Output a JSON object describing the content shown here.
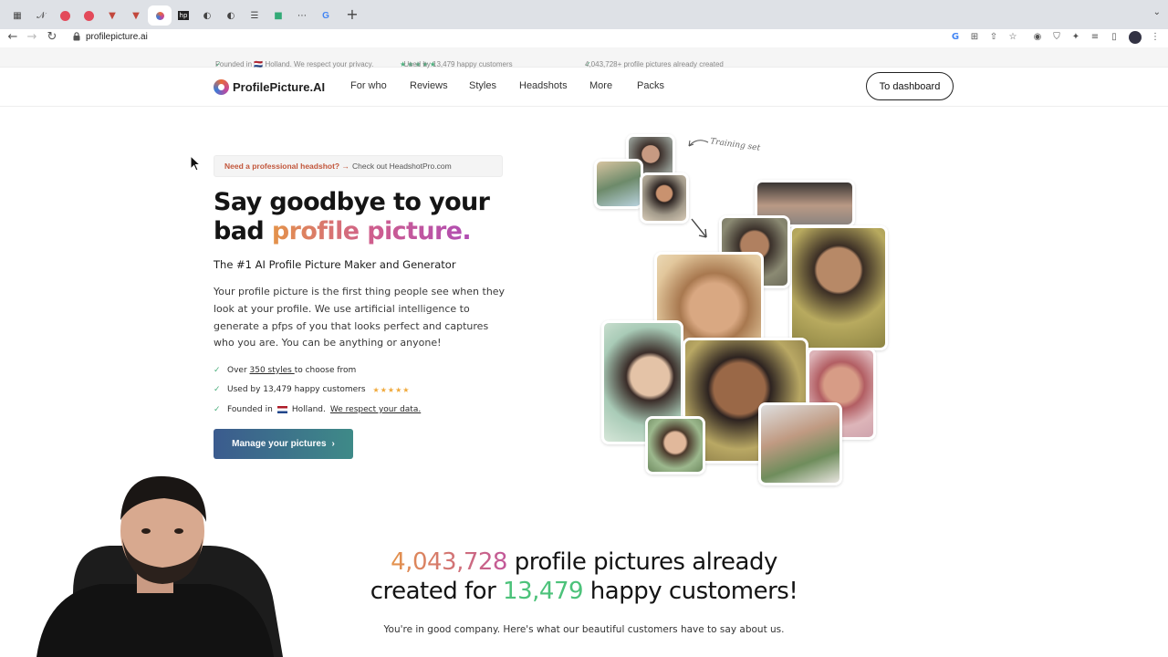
{
  "browser": {
    "url": "profilepicture.ai",
    "tabs": [
      "tab-1",
      "tab-2",
      "tab-3",
      "tab-4",
      "tab-5",
      "tab-6",
      "tab-active",
      "tab-8",
      "tab-9",
      "tab-10",
      "tab-11",
      "tab-12",
      "tab-13"
    ],
    "new_tab": "+"
  },
  "announce": {
    "founded": "Founded in 🇳🇱 Holland. We respect your privacy.",
    "stars": "★★★★★",
    "used_by": "Used by 13,479 happy customers",
    "created": "4,043,728+ profile pictures already created"
  },
  "nav": {
    "logo": "ProfilePicture.AI",
    "links": [
      "For who",
      "Reviews",
      "Styles",
      "Headshots",
      "More",
      "Packs"
    ],
    "dashboard": "To dashboard"
  },
  "hero": {
    "pill_strong": "Need a professional headshot? →",
    "pill_rest": "Check out HeadshotPro.com",
    "title_line1": "Say goodbye to your",
    "title_line2_plain": "bad ",
    "title_line2_grad": "profile picture.",
    "subtitle": "The #1 AI Profile Picture Maker and Generator",
    "description": "Your profile picture is the first thing people see when they look at your profile. We use artificial intelligence to generate a pfps of you that looks perfect and captures who you are. You can be anything or anyone!",
    "bullet1_pre": "Over ",
    "bullet1_link": "350 styles ",
    "bullet1_post": "to choose from",
    "bullet2": "Used by 13,479 happy customers",
    "bullet2_stars": "★★★★★",
    "bullet3_pre": "Founded in",
    "bullet3_mid": "Holland.",
    "bullet3_link": "We respect your data.",
    "cta": "Manage your pictures",
    "cta_chevron": "›",
    "training_label": "Training set"
  },
  "stats": {
    "count_pictures": "4,043,728",
    "line1_rest": " profile pictures already",
    "line2_pre": "created for ",
    "count_customers": "13,479",
    "line2_post": " happy customers!",
    "company": "You're in good company. Here's what our beautiful customers have to say about us."
  },
  "colors": {
    "accent_green": "#4caf7d",
    "cta_gradient_start": "#3b5b8e",
    "cta_gradient_end": "#3e8a88",
    "title_gradient": "#cf5e8d"
  }
}
